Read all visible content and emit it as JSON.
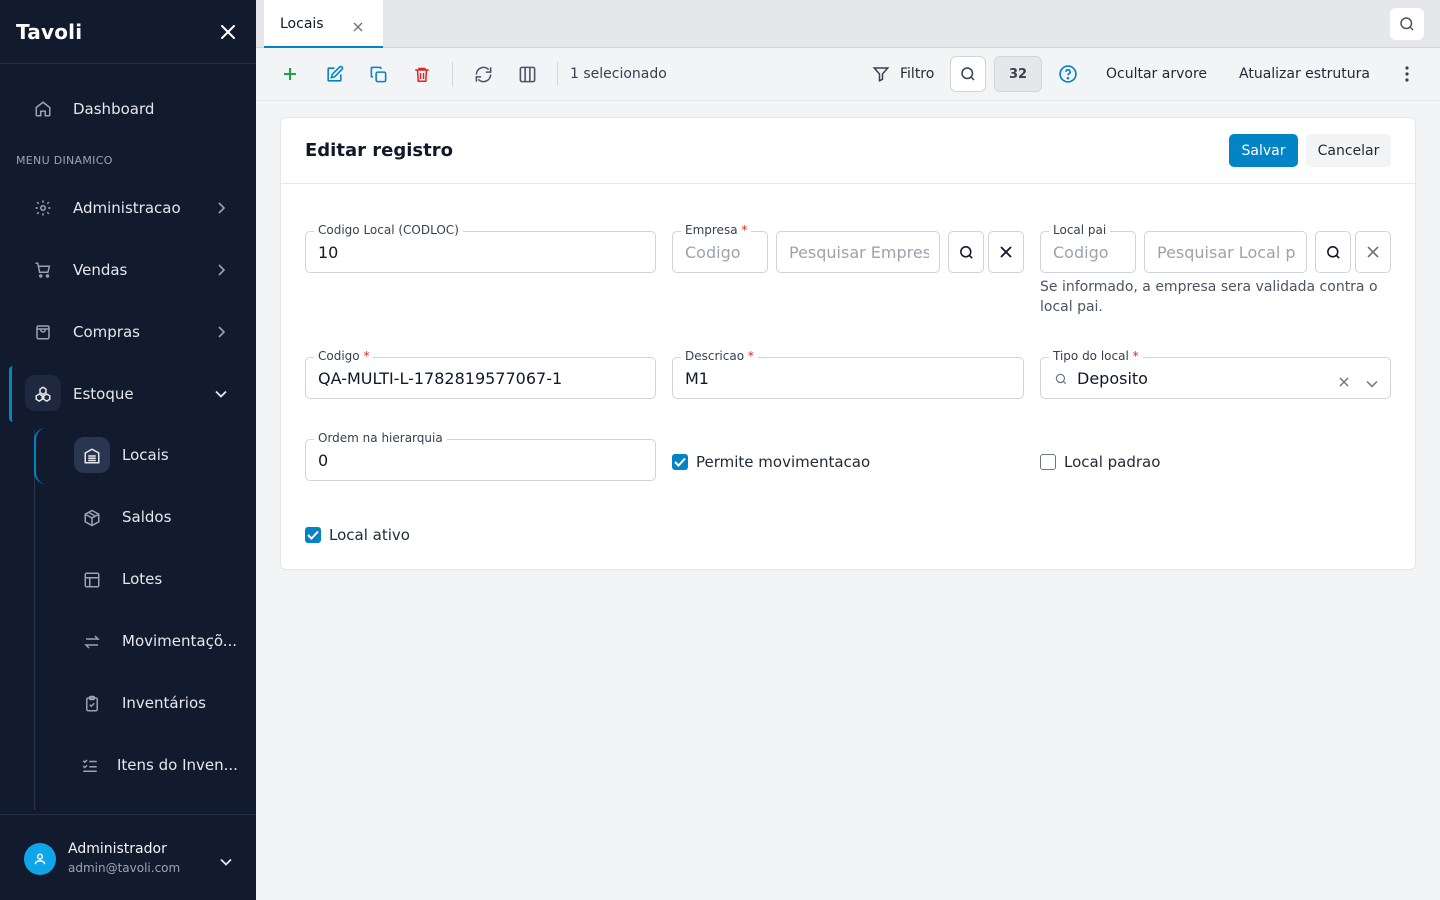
{
  "app": {
    "brand": "Tavoli"
  },
  "sidebar": {
    "dashboard": "Dashboard",
    "section_label": "MENU DINAMICO",
    "items": [
      {
        "label": "Administracao",
        "icon": "gear-icon"
      },
      {
        "label": "Vendas",
        "icon": "cart-icon"
      },
      {
        "label": "Compras",
        "icon": "bag-icon"
      },
      {
        "label": "Estoque",
        "icon": "boxes-icon"
      }
    ],
    "subitems": [
      {
        "label": "Locais",
        "icon": "warehouse-icon"
      },
      {
        "label": "Saldos",
        "icon": "package-icon"
      },
      {
        "label": "Lotes",
        "icon": "layout-icon"
      },
      {
        "label": "Movimentaçõ...",
        "icon": "arrows-icon"
      },
      {
        "label": "Inventários",
        "icon": "clipboard-icon"
      },
      {
        "label": "Itens do Inven...",
        "icon": "list-check-icon"
      }
    ],
    "user": {
      "name": "Administrador",
      "email": "admin@tavoli.com"
    }
  },
  "tabs": [
    {
      "label": "Locais",
      "active": true
    }
  ],
  "toolbar": {
    "selection_text": "1 selecionado",
    "filter_label": "Filtro",
    "count": "32",
    "hide_tree": "Ocultar arvore",
    "update_structure": "Atualizar estrutura"
  },
  "form": {
    "title": "Editar registro",
    "save": "Salvar",
    "cancel": "Cancelar",
    "codloc": {
      "label": "Codigo Local (CODLOC)",
      "value": "10"
    },
    "empresa": {
      "label": "Empresa",
      "code_placeholder": "Codigo",
      "search_placeholder": "Pesquisar Empres"
    },
    "local_pai": {
      "label": "Local pai",
      "code_placeholder": "Codigo",
      "search_placeholder": "Pesquisar Local p",
      "hint": "Se informado, a empresa sera validada contra o local pai."
    },
    "codigo": {
      "label": "Codigo",
      "value": "QA-MULTI-L-1782819577067-1"
    },
    "descricao": {
      "label": "Descricao",
      "value": "M1"
    },
    "tipo_local": {
      "label": "Tipo do local",
      "value": "Deposito"
    },
    "ordem": {
      "label": "Ordem na hierarquia",
      "value": "0"
    },
    "permite_mov": {
      "label": "Permite movimentacao",
      "checked": true
    },
    "local_padrao": {
      "label": "Local padrao",
      "checked": false
    },
    "local_ativo": {
      "label": "Local ativo",
      "checked": true
    }
  },
  "colors": {
    "accent": "#0284c7",
    "sidebar_bg": "#121b2e",
    "danger": "#dc2626",
    "success": "#16a34a"
  }
}
